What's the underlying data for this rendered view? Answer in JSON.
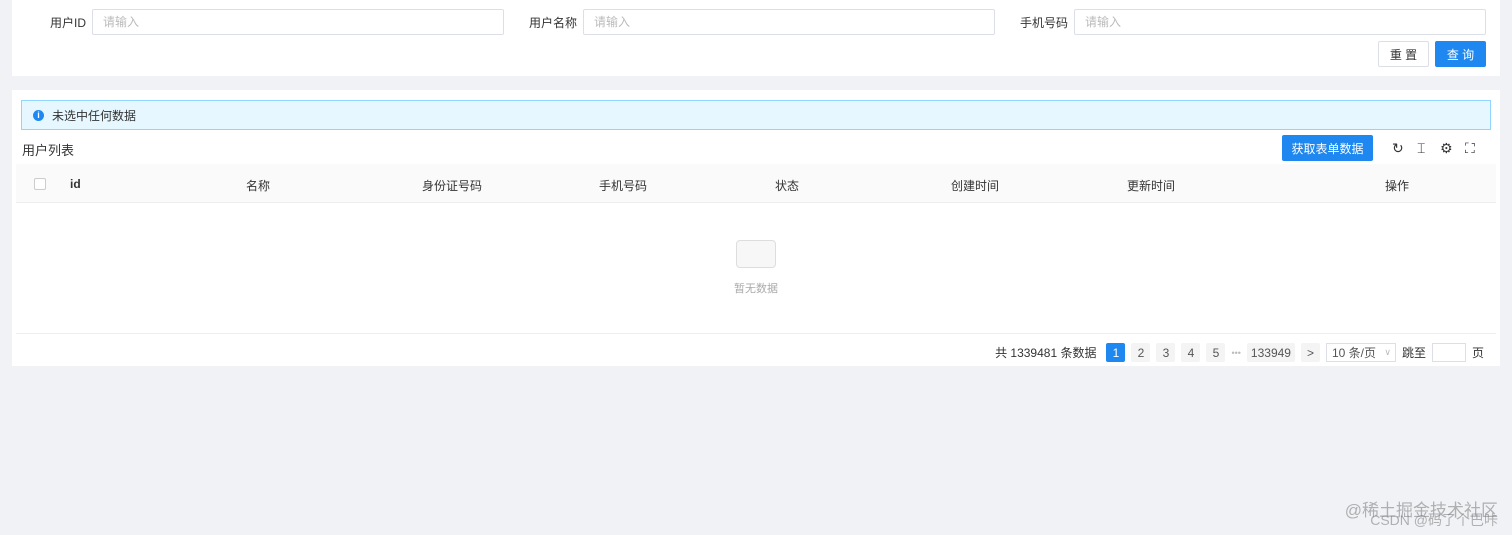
{
  "search": {
    "fields": [
      {
        "label": "用户ID",
        "placeholder": "请输入"
      },
      {
        "label": "用户名称",
        "placeholder": "请输入"
      },
      {
        "label": "手机号码",
        "placeholder": "请输入"
      }
    ],
    "reset_label": "重 置",
    "query_label": "查 询"
  },
  "alert": {
    "text": "未选中任何数据"
  },
  "table": {
    "title": "用户列表",
    "fetch_label": "获取表单数据",
    "columns": [
      "id",
      "名称",
      "身份证号码",
      "手机号码",
      "状态",
      "创建时间",
      "更新时间",
      "操作"
    ],
    "empty_text": "暂无数据"
  },
  "pagination": {
    "total_text": "共 1339481 条数据",
    "pages": [
      "1",
      "2",
      "3",
      "4",
      "5"
    ],
    "ellipsis": "•••",
    "last_page": "133949",
    "next": ">",
    "page_size": "10 条/页",
    "jump_label": "跳至",
    "page_suffix": "页",
    "current": 1
  },
  "watermark": {
    "line1": "@稀土掘金技术社区",
    "line2": "CSDN @码了个巴咔"
  },
  "colors": {
    "primary": "#1e88f0",
    "background": "#f0f2f5"
  }
}
